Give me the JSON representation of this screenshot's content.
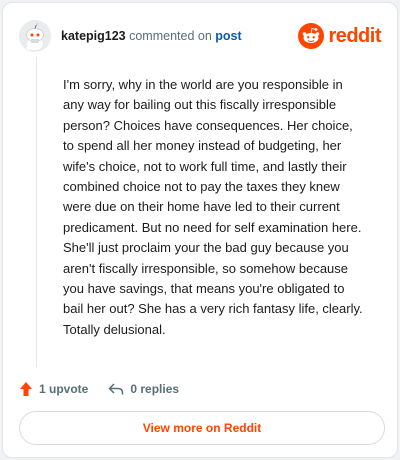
{
  "comment": {
    "username": "katepig123",
    "commented_on_text": "commented on",
    "post_link": "post",
    "body": "I'm sorry, why in the world are you responsible in any way for bailing out this fiscally irresponsible person? Choices have consequences. Her choice, to spend all her money instead of budgeting, her wife's choice, not to work full time, and lastly their combined choice not to pay the taxes they knew were due on their home have led to their current predicament. But no need for self examination here. She'll just proclaim your the bad guy because you aren't fiscally irresponsible, so somehow because you have savings, that means you're obligated to bail her out? She has a very rich fantasy life, clearly. Totally delusional.",
    "upvotes_label": "1 upvote",
    "replies_label": "0 replies"
  },
  "brand": {
    "wordmark": "reddit",
    "accent_color": "#ff4500"
  },
  "icons": {
    "avatar": "snoo-avatar-icon",
    "logo": "reddit-logo-icon",
    "upvote": "upvote-arrow-icon",
    "reply": "reply-arrow-icon"
  },
  "footer": {
    "view_more_label": "View more on Reddit"
  }
}
